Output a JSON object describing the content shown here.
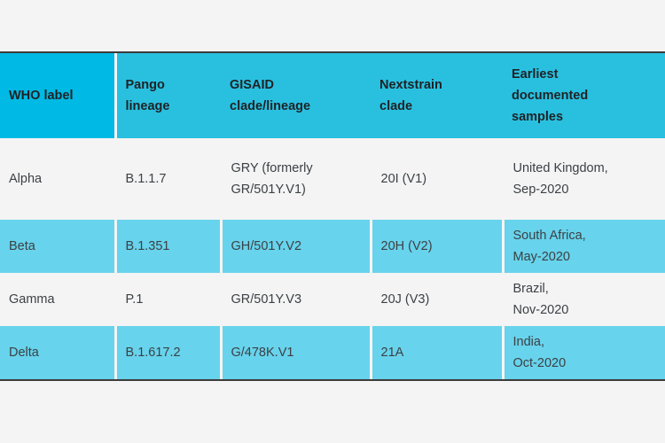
{
  "table": {
    "name": "sars-cov-2-variants-of-concern",
    "colors": {
      "header_first_cell": "#00b9e4",
      "header_cell": "#29c0e0",
      "row_alt_band": "#68d3ec",
      "row_plain_band": "#f4f4f4",
      "page_background": "#f4f4f4",
      "rule": "#3c3c3c",
      "header_text": "#1f2224",
      "body_text": "#3b4145"
    },
    "headers": [
      "WHO label",
      "Pango lineage",
      "GISAID clade/lineage",
      "Nextstrain clade",
      "Earliest documented samples"
    ],
    "headers_wrapped": [
      [
        "WHO label"
      ],
      [
        "Pango",
        "lineage"
      ],
      [
        "GISAID",
        "clade/lineage"
      ],
      [
        "Nextstrain",
        "clade"
      ],
      [
        "Earliest",
        "documented",
        "samples"
      ]
    ],
    "rows": [
      {
        "band": "plain",
        "who_label": "Alpha",
        "pango_lineage": "B.1.1.7",
        "gisaid_clade": "GRY (formerly GR/501Y.V1)",
        "gisaid_clade_lines": [
          "GRY (formerly",
          "GR/501Y.V1)"
        ],
        "nextstrain_clade": "20I (V1)",
        "earliest_samples": "United Kingdom, Sep-2020",
        "earliest_samples_lines": [
          "United Kingdom,",
          "Sep-2020"
        ]
      },
      {
        "band": "alt",
        "who_label": "Beta",
        "pango_lineage": "B.1.351",
        "gisaid_clade": "GH/501Y.V2",
        "gisaid_clade_lines": [
          "GH/501Y.V2"
        ],
        "nextstrain_clade": "20H (V2)",
        "earliest_samples": "South Africa, May-2020",
        "earliest_samples_lines": [
          "South Africa,",
          "May-2020"
        ]
      },
      {
        "band": "plain",
        "who_label": "Gamma",
        "pango_lineage": "P.1",
        "gisaid_clade": "GR/501Y.V3",
        "gisaid_clade_lines": [
          "GR/501Y.V3"
        ],
        "nextstrain_clade": "20J (V3)",
        "earliest_samples": "Brazil, Nov-2020",
        "earliest_samples_lines": [
          "Brazil,",
          "Nov-2020"
        ]
      },
      {
        "band": "alt",
        "who_label": "Delta",
        "pango_lineage": "B.1.617.2",
        "gisaid_clade": "G/478K.V1",
        "gisaid_clade_lines": [
          "G/478K.V1"
        ],
        "nextstrain_clade": "21A",
        "earliest_samples": "India, Oct-2020",
        "earliest_samples_lines": [
          "India,",
          "Oct-2020"
        ]
      }
    ]
  }
}
